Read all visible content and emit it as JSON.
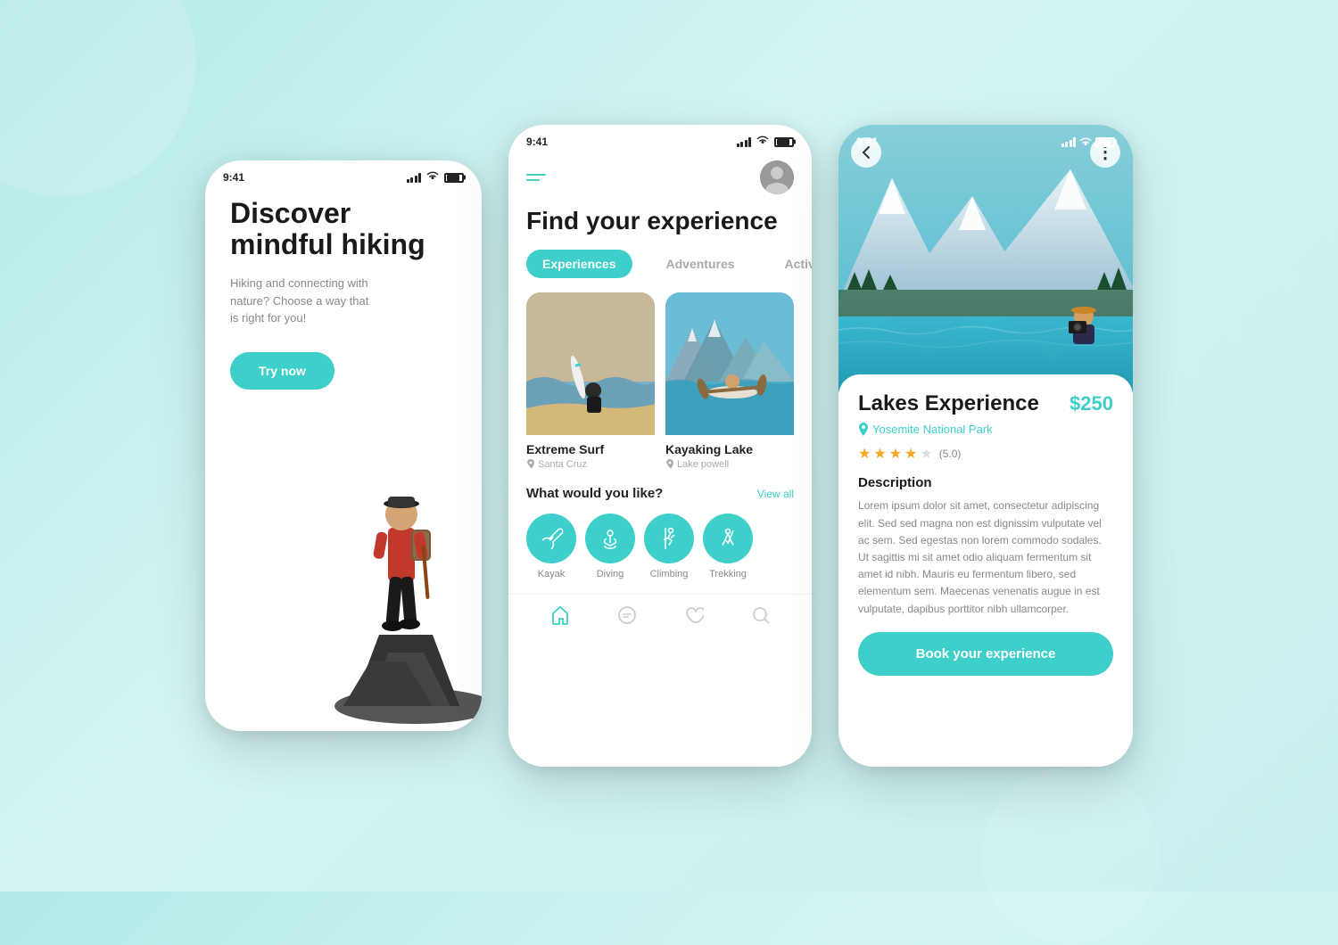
{
  "background": {
    "color": "#b2eae8"
  },
  "phone1": {
    "status_time": "9:41",
    "headline": "Discover mindful hiking",
    "subtext": "Hiking and connecting with nature? Choose a way that is right for you!",
    "cta_button": "Try now"
  },
  "phone2": {
    "status_time": "9:41",
    "title": "Find your experience",
    "tabs": [
      {
        "label": "Experiences",
        "active": true
      },
      {
        "label": "Adventures",
        "active": false
      },
      {
        "label": "Activities",
        "active": false
      }
    ],
    "cards": [
      {
        "title": "Extreme Surf",
        "location": "Santa Cruz"
      },
      {
        "title": "Kayaking Lake",
        "location": "Lake powell"
      }
    ],
    "section_title": "What would you like?",
    "view_all": "View all",
    "activities": [
      {
        "label": "Kayak",
        "icon": "🚣"
      },
      {
        "label": "Diving",
        "icon": "🤿"
      },
      {
        "label": "Climbing",
        "icon": "🧗"
      },
      {
        "label": "Trekking",
        "icon": "🥾"
      }
    ],
    "nav": [
      "home",
      "message",
      "heart",
      "search"
    ]
  },
  "phone3": {
    "status_time": "9:41",
    "title": "Lakes Experience",
    "price": "$250",
    "location": "Yosemite National Park",
    "rating": "5.0",
    "rating_stars": 4.5,
    "description_title": "Description",
    "description": "Lorem ipsum dolor sit amet, consectetur adipiscing elit. Sed sed magna non est dignissim vulputate vel ac sem. Sed egestas non lorem commodo sodales. Ut sagittis mi sit amet odio aliquam fermentum sit amet id nibh. Mauris eu fermentum libero, sed elementum sem. Maecenas venenatis augue in est vulputate, dapibus porttitor nibh ullamcorper.",
    "book_button": "Book your experience"
  }
}
